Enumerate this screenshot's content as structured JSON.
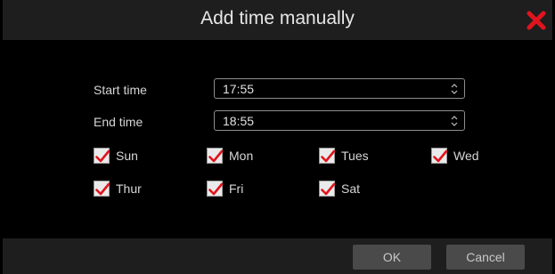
{
  "dialog": {
    "title": "Add time manually"
  },
  "form": {
    "start_label": "Start time",
    "start_value": "17:55",
    "end_label": "End time",
    "end_value": "18:55"
  },
  "days": [
    {
      "label": "Sun",
      "checked": true
    },
    {
      "label": "Mon",
      "checked": true
    },
    {
      "label": "Tues",
      "checked": true
    },
    {
      "label": "Wed",
      "checked": true
    },
    {
      "label": "Thur",
      "checked": true
    },
    {
      "label": "Fri",
      "checked": true
    },
    {
      "label": "Sat",
      "checked": true
    }
  ],
  "buttons": {
    "ok": "OK",
    "cancel": "Cancel"
  },
  "icons": {
    "close": "close-icon",
    "check": "checkmark-icon",
    "spinner": "up-down-spinner-icon"
  },
  "colors": {
    "accent": "#e0141e",
    "titlebar": "#1e1e1e",
    "background": "#000000"
  }
}
